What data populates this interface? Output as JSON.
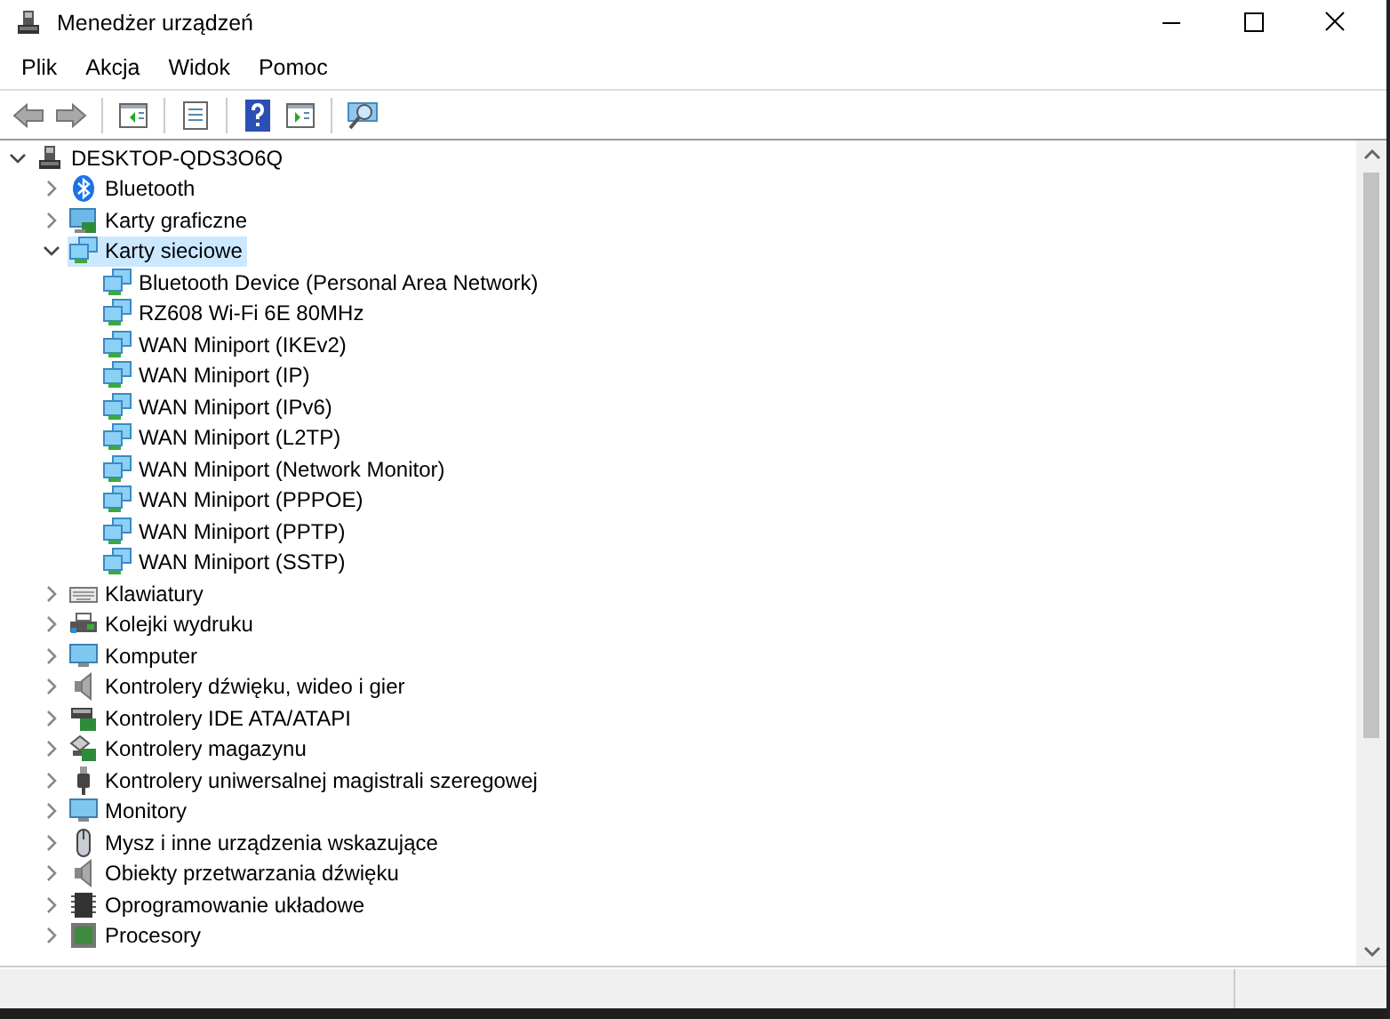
{
  "window": {
    "title": "Menedżer urządzeń"
  },
  "menu": [
    "Plik",
    "Akcja",
    "Widok",
    "Pomoc"
  ],
  "toolbar": [
    {
      "kind": "back",
      "disabled": true
    },
    {
      "kind": "forward",
      "disabled": true
    },
    {
      "kind": "sep"
    },
    {
      "kind": "pane"
    },
    {
      "kind": "sep"
    },
    {
      "kind": "props"
    },
    {
      "kind": "sep"
    },
    {
      "kind": "help"
    },
    {
      "kind": "run"
    },
    {
      "kind": "sep"
    },
    {
      "kind": "scan"
    }
  ],
  "tree": {
    "label": "DESKTOP-QDS3O6Q",
    "kind": "computer-root",
    "expanded": true,
    "selected": false,
    "children": [
      {
        "label": "Bluetooth",
        "kind": "bluetooth",
        "expanded": false,
        "selected": false
      },
      {
        "label": "Karty graficzne",
        "kind": "display",
        "expanded": false,
        "selected": false
      },
      {
        "label": "Karty sieciowe",
        "kind": "network",
        "expanded": true,
        "selected": true,
        "children": [
          {
            "label": "Bluetooth Device (Personal Area Network)",
            "kind": "network",
            "selected": false
          },
          {
            "label": "RZ608 Wi-Fi 6E 80MHz",
            "kind": "network",
            "selected": false
          },
          {
            "label": "WAN Miniport (IKEv2)",
            "kind": "network",
            "selected": false
          },
          {
            "label": "WAN Miniport (IP)",
            "kind": "network",
            "selected": false
          },
          {
            "label": "WAN Miniport (IPv6)",
            "kind": "network",
            "selected": false
          },
          {
            "label": "WAN Miniport (L2TP)",
            "kind": "network",
            "selected": false
          },
          {
            "label": "WAN Miniport (Network Monitor)",
            "kind": "network",
            "selected": false
          },
          {
            "label": "WAN Miniport (PPPOE)",
            "kind": "network",
            "selected": false
          },
          {
            "label": "WAN Miniport (PPTP)",
            "kind": "network",
            "selected": false
          },
          {
            "label": "WAN Miniport (SSTP)",
            "kind": "network",
            "selected": false
          }
        ]
      },
      {
        "label": "Klawiatury",
        "kind": "keyboard",
        "expanded": false,
        "selected": false
      },
      {
        "label": "Kolejki wydruku",
        "kind": "printer",
        "expanded": false,
        "selected": false
      },
      {
        "label": "Komputer",
        "kind": "monitor",
        "expanded": false,
        "selected": false
      },
      {
        "label": "Kontrolery dźwięku, wideo i gier",
        "kind": "speaker",
        "expanded": false,
        "selected": false
      },
      {
        "label": "Kontrolery IDE ATA/ATAPI",
        "kind": "ide",
        "expanded": false,
        "selected": false
      },
      {
        "label": "Kontrolery magazynu",
        "kind": "storage",
        "expanded": false,
        "selected": false
      },
      {
        "label": "Kontrolery uniwersalnej magistrali szeregowej",
        "kind": "usb",
        "expanded": false,
        "selected": false
      },
      {
        "label": "Monitory",
        "kind": "monitor",
        "expanded": false,
        "selected": false
      },
      {
        "label": "Mysz i inne urządzenia wskazujące",
        "kind": "mouse",
        "expanded": false,
        "selected": false
      },
      {
        "label": "Obiekty przetwarzania dźwięku",
        "kind": "speaker",
        "expanded": false,
        "selected": false
      },
      {
        "label": "Oprogramowanie układowe",
        "kind": "chip",
        "expanded": false,
        "selected": false
      },
      {
        "label": "Procesory",
        "kind": "processor",
        "expanded": false,
        "selected": false
      }
    ]
  }
}
